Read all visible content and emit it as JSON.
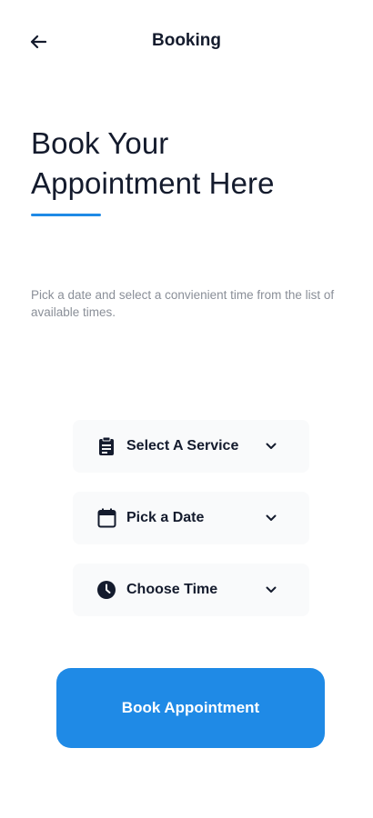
{
  "header": {
    "back_icon": "arrow-left-icon",
    "title": "Booking"
  },
  "hero": {
    "headline": "Book Your Appointment Here",
    "accent_color": "#1f8ae6"
  },
  "description": "Pick a date and select a convienient time from the list of available times.",
  "selectors": [
    {
      "icon": "clipboard-icon",
      "label": "Select A Service",
      "chevron": "chevron-down-icon"
    },
    {
      "icon": "calendar-icon",
      "label": "Pick a Date",
      "chevron": "chevron-down-icon"
    },
    {
      "icon": "clock-icon",
      "label": "Choose Time",
      "chevron": "chevron-down-icon"
    }
  ],
  "cta": {
    "label": "Book Appointment",
    "color": "#1f8ae6"
  }
}
